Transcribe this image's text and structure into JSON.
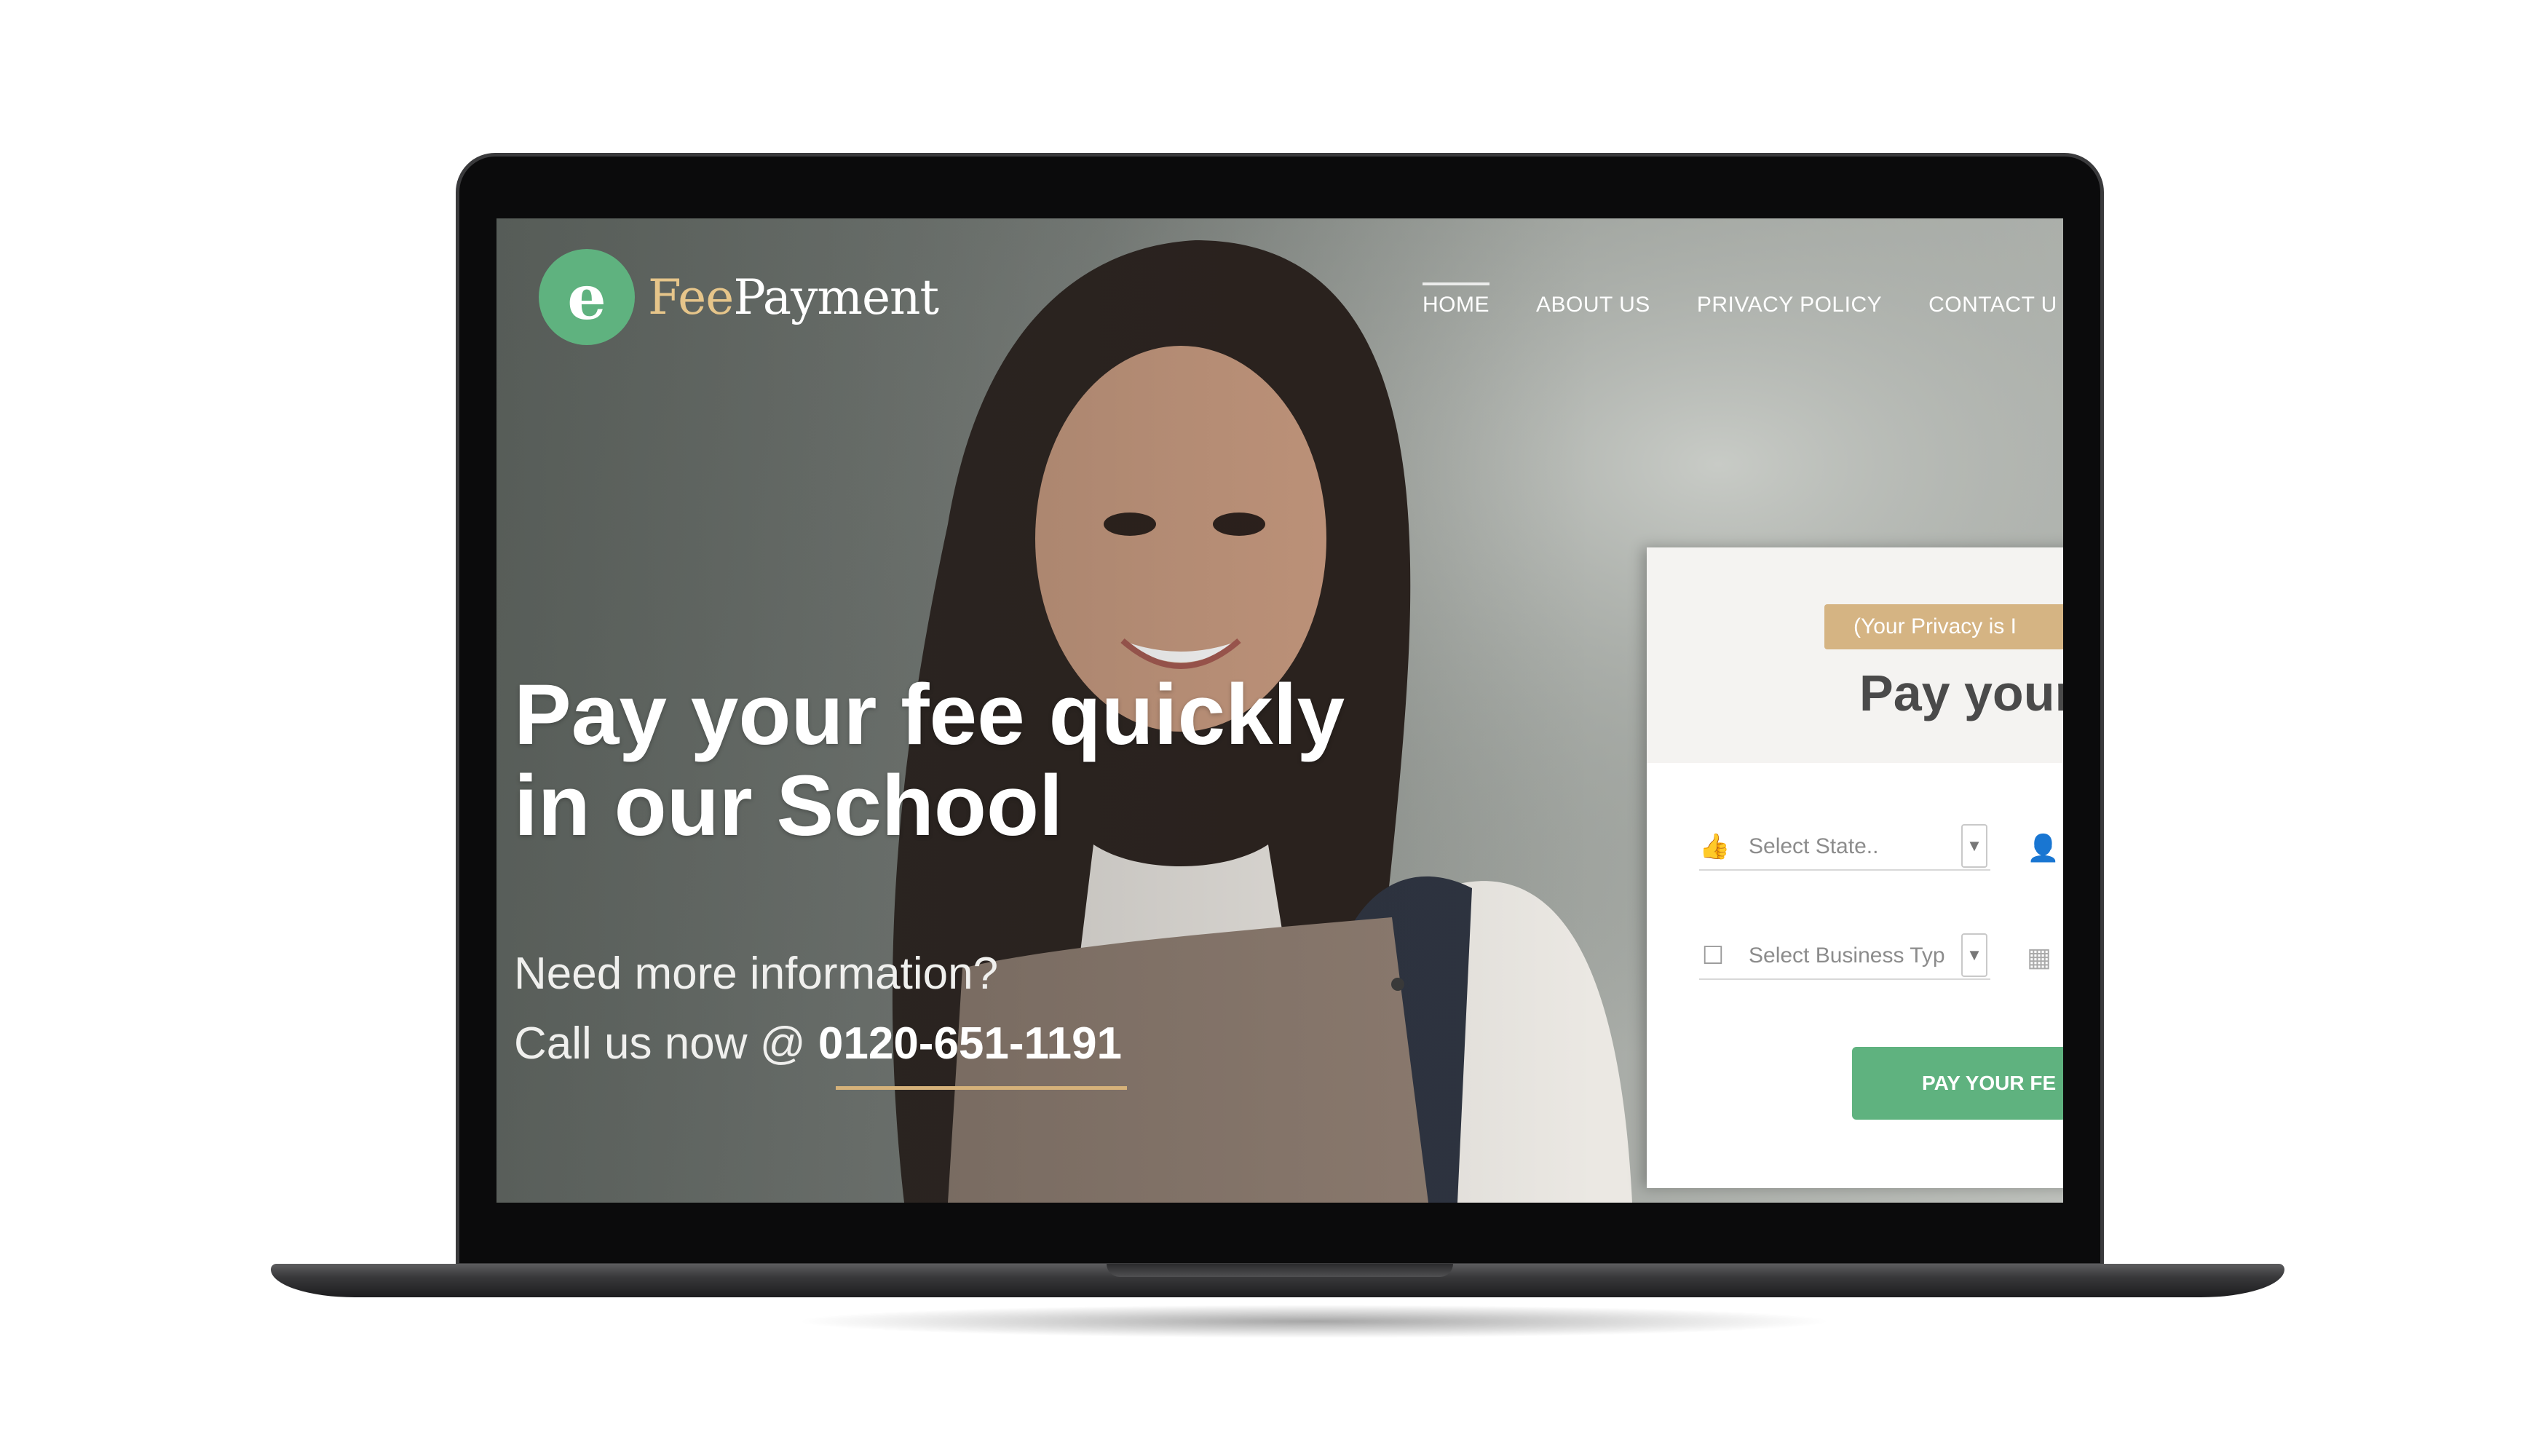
{
  "logo": {
    "mark": "e",
    "name_part1": "Fee",
    "name_part2": "Payment"
  },
  "nav": {
    "items": [
      {
        "label": "HOME",
        "active": true
      },
      {
        "label": "ABOUT US",
        "active": false
      },
      {
        "label": "PRIVACY POLICY",
        "active": false
      },
      {
        "label": "CONTACT U",
        "active": false
      }
    ]
  },
  "hero": {
    "title_line1": "Pay your fee quickly",
    "title_line2": "in our School",
    "info_line1": "Need more information?",
    "info_line2_prefix": "Call us now @",
    "phone": "0120-651-1191"
  },
  "form": {
    "privacy_badge": "(Your Privacy is I",
    "title": "Pay your",
    "state_placeholder": "Select State..",
    "business_placeholder": "Select Business Typ",
    "submit_label": "PAY YOUR FE"
  },
  "colors": {
    "brand_green": "#5fb27f",
    "accent_gold": "#d5b483"
  },
  "icons": {
    "state_field": "thumbs-up-icon",
    "business_field": "checkbox-icon",
    "user_field": "user-icon",
    "building_field": "building-icon"
  }
}
